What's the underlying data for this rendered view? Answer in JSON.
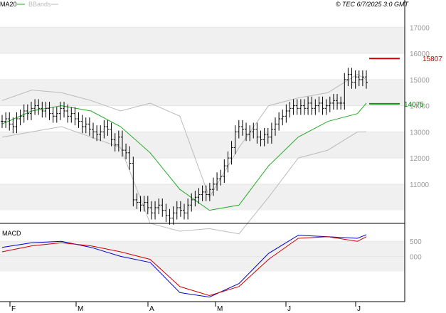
{
  "header": {
    "legend": [
      {
        "label": "MA20",
        "color": "#22aa22"
      },
      {
        "label": "BBands",
        "color": "#bbbbbb"
      }
    ],
    "timestamp": "© TEC 6/7/2025 3:0 GMT"
  },
  "colors": {
    "band": "#f0f0f0",
    "grid": "#e6e6e6",
    "price": "#000000",
    "ma": "#22aa22",
    "bbands": "#bbbbbb",
    "resistance": "#cc0000",
    "support": "#009900",
    "macd": "#0000cc",
    "signal": "#cc0000"
  },
  "chart_data": [
    {
      "type": "line",
      "title": "",
      "ylim": [
        9500,
        17500
      ],
      "y_ticks": [
        "17000",
        "16000",
        "15000",
        "14000",
        "13000",
        "12000",
        "11000"
      ],
      "x_ticks": [
        "F",
        "M",
        "A",
        "M",
        "J",
        "J"
      ],
      "series": [
        {
          "name": "MA20",
          "x": [
            0,
            10,
            20,
            30,
            40,
            50,
            60,
            70,
            80,
            90,
            100,
            110,
            120,
            123
          ],
          "y": [
            13300,
            13800,
            14000,
            13800,
            13200,
            12200,
            10800,
            10000,
            10200,
            11700,
            12800,
            13400,
            13700,
            14100
          ]
        },
        {
          "name": "BBands",
          "part": "upper",
          "x": [
            0,
            10,
            20,
            30,
            40,
            50,
            60,
            70,
            80,
            90,
            100,
            110,
            120,
            123
          ],
          "y": [
            14200,
            14600,
            14500,
            14200,
            13800,
            14100,
            13600,
            10500,
            12400,
            14000,
            14300,
            14500,
            15200,
            15000
          ]
        },
        {
          "name": "BBands",
          "part": "lower",
          "x": [
            0,
            10,
            20,
            30,
            40,
            50,
            60,
            70,
            80,
            90,
            100,
            110,
            120,
            123
          ],
          "y": [
            12800,
            13000,
            13200,
            12800,
            12400,
            9500,
            9200,
            9300,
            9100,
            10500,
            12000,
            12300,
            13000,
            13000
          ]
        }
      ],
      "closes": [
        13400,
        13500,
        13300,
        13200,
        13500,
        13600,
        13800,
        13700,
        13900,
        14000,
        13900,
        13800,
        13900,
        13700,
        13600,
        13700,
        13900,
        13800,
        13600,
        13700,
        13500,
        13400,
        13200,
        13300,
        13100,
        13000,
        12900,
        13000,
        13200,
        13100,
        12700,
        12500,
        12800,
        12300,
        12200,
        11800,
        10400,
        10300,
        10200,
        10300,
        10100,
        9900,
        10100,
        10200,
        10000,
        9800,
        9700,
        9900,
        10100,
        10000,
        9900,
        10200,
        10400,
        10500,
        10600,
        10700,
        10600,
        10800,
        11000,
        11200,
        11300,
        11700,
        12000,
        12400,
        13000,
        13200,
        13100,
        12900,
        13000,
        13100,
        12800,
        12700,
        12900,
        12800,
        13100,
        13300,
        13500,
        13600,
        13800,
        13900,
        14000,
        13900,
        14000,
        13900,
        14100,
        13900,
        14000,
        14100,
        13900,
        14000,
        14100,
        14200,
        14100,
        14100,
        15000,
        15200,
        14900,
        15100,
        15000,
        15100,
        14900
      ],
      "levels": [
        {
          "value": 15807,
          "label": "15807",
          "color": "#cc0000"
        },
        {
          "value": 14075,
          "label": "14075",
          "color": "#009900"
        }
      ]
    },
    {
      "type": "line",
      "title": "MACD",
      "ylim": [
        -1500,
        1000
      ],
      "y_ticks": [
        "500",
        "000"
      ],
      "series": [
        {
          "name": "MACD",
          "x": [
            0,
            10,
            20,
            30,
            40,
            50,
            60,
            70,
            80,
            90,
            100,
            110,
            120,
            123
          ],
          "y": [
            300,
            450,
            500,
            300,
            0,
            -200,
            -1200,
            -1350,
            -900,
            100,
            700,
            650,
            600,
            720
          ]
        },
        {
          "name": "Signal",
          "x": [
            0,
            10,
            20,
            30,
            40,
            50,
            60,
            70,
            80,
            90,
            100,
            110,
            120,
            123
          ],
          "y": [
            150,
            350,
            450,
            350,
            150,
            -100,
            -1000,
            -1300,
            -1000,
            -100,
            600,
            650,
            500,
            650
          ]
        }
      ]
    }
  ]
}
